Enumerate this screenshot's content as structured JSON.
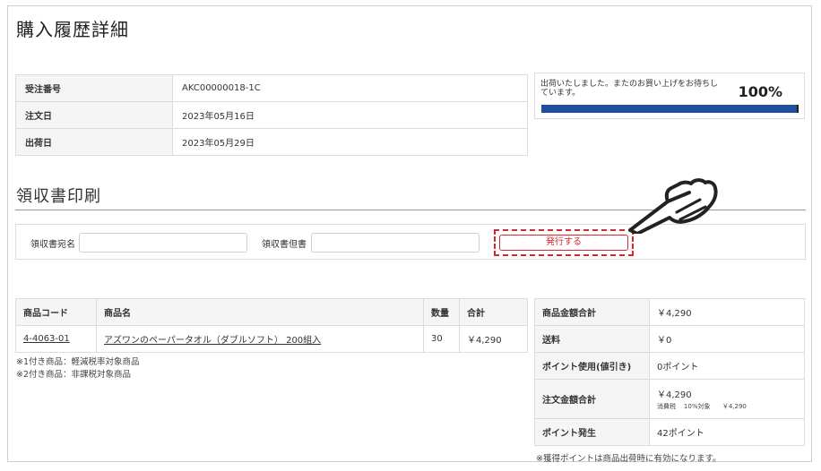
{
  "page_title": "購入履歴詳細",
  "order_info": [
    {
      "label": "受注番号",
      "value": "AKC00000018-1C"
    },
    {
      "label": "注文日",
      "value": "2023年05月16日"
    },
    {
      "label": "出荷日",
      "value": "2023年05月29日"
    }
  ],
  "status": {
    "message": "出荷いたしました。またのお買い上げをお待ちしています。",
    "percent_label": "100%",
    "progress": 1.0,
    "bar_color": "#1f4f9a"
  },
  "receipt": {
    "section_title": "領収書印刷",
    "addressee_label": "領収書宛名",
    "addressee_value": "",
    "note_label": "領収書但書",
    "note_value": "",
    "issue_button": "発行する",
    "highlight_color": "#d6282f"
  },
  "products": {
    "headers": {
      "code": "商品コード",
      "name": "商品名",
      "qty": "数量",
      "total": "合計"
    },
    "rows": [
      {
        "code": "4-4063-01",
        "name": "アズワンのペーパータオル（ダブルソフト） 200組入",
        "qty": "30",
        "total": "￥4,290"
      }
    ],
    "notes": [
      "※1付き商品：軽減税率対象商品",
      "※2付き商品：非課税対象商品"
    ]
  },
  "totals": {
    "subtotal_label": "商品金額合計",
    "subtotal_value": "￥4,290",
    "shipping_label": "送料",
    "shipping_value": "￥0",
    "points_used_label": "ポイント使用(値引き)",
    "points_used_value": "0ポイント",
    "order_total_label": "注文金額合計",
    "order_total_value": "￥4,290",
    "tax_label": "消費税",
    "tax_rate_label": "10%対象",
    "tax_value": "￥4,290",
    "points_earned_label": "ポイント発生",
    "points_earned_value": "42ポイント",
    "points_note": "※獲得ポイントは商品出荷時に有効になります。"
  },
  "icons": {
    "pointer": "pointing-hand-icon"
  }
}
